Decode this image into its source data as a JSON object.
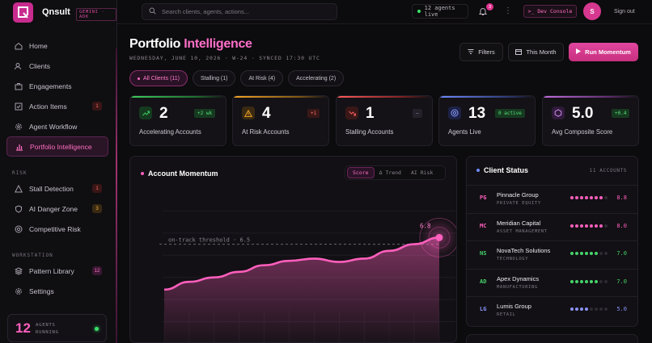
{
  "app": {
    "brand": "Qnsult",
    "badge": "GEMINI · ADK"
  },
  "sidebar": {
    "items": [
      {
        "label": "Home",
        "icon": "home-icon"
      },
      {
        "label": "Clients",
        "icon": "users-icon"
      },
      {
        "label": "Engagements",
        "icon": "briefcase-icon"
      },
      {
        "label": "Action Items",
        "icon": "checkbox-icon",
        "count": "1"
      },
      {
        "label": "Agent Workflow",
        "icon": "gear-icon"
      },
      {
        "label": "Portfolio Intelligence",
        "icon": "bar-chart-icon",
        "active": true
      }
    ],
    "risk_label": "RISK",
    "risk_items": [
      {
        "label": "Stall Detection",
        "icon": "warning-icon",
        "count": "1"
      },
      {
        "label": "AI Danger Zone",
        "icon": "shield-icon",
        "count": "3"
      },
      {
        "label": "Competitive Risk",
        "icon": "target-icon"
      }
    ],
    "workstation_label": "WORKSTATION",
    "workstation_items": [
      {
        "label": "Pattern Library",
        "icon": "layers-icon",
        "count": "12"
      },
      {
        "label": "Settings",
        "icon": "gear-icon"
      }
    ],
    "agents": {
      "count": "12",
      "label_line1": "AGENTS",
      "label_line2": "RUNNING"
    }
  },
  "topbar": {
    "search_placeholder": "Search clients, agents, actions...",
    "agents_live": "12 agents live",
    "notifications": "3",
    "dev_console": ">_ Dev Console",
    "avatar": "S",
    "sign_out": "Sign out"
  },
  "header": {
    "title_a": "Portfolio",
    "title_b": "Intelligence",
    "subline": "WEDNESDAY, JUNE 10, 2026 · W-24 · SYNCED 17:30 UTC",
    "filters_btn": "Filters",
    "month_btn": "This Month",
    "run_btn": "Run Momentum"
  },
  "filters": [
    {
      "label": "All Clients (11)",
      "active": true
    },
    {
      "label": "Stalling (1)"
    },
    {
      "label": "At Risk (4)"
    },
    {
      "label": "Accelerating (2)"
    }
  ],
  "kpis": [
    {
      "value": "2",
      "label": "Accelerating Accounts",
      "delta": "+2 wk",
      "icon": "trend-up-icon",
      "color": "#3ecf5c"
    },
    {
      "value": "4",
      "label": "At Risk Accounts",
      "delta": "+1",
      "icon": "warning-icon",
      "color": "#f5a524"
    },
    {
      "value": "1",
      "label": "Stalling Accounts",
      "delta": "–",
      "icon": "trend-down-icon",
      "color": "#ff5b5b"
    },
    {
      "value": "13",
      "label": "Agents Live",
      "delta": "0 active",
      "icon": "target-icon",
      "color": "#6f8cff"
    },
    {
      "value": "5.0",
      "label": "Avg Composite Score",
      "delta": "+0.4",
      "icon": "hexagon-icon",
      "color": "#c46ee0"
    }
  ],
  "momentum": {
    "title": "Account Momentum",
    "tabs": [
      "Score",
      "Δ Trend",
      "AI Risk"
    ],
    "threshold_label": "on-track threshold · 6.5"
  },
  "chart_data": {
    "type": "area",
    "y": [
      4.45,
      4.8,
      5.0,
      5.25,
      5.55,
      5.75,
      5.85,
      5.7,
      5.85,
      6.2,
      6.5,
      6.8
    ],
    "ylim": [
      2,
      9
    ],
    "threshold": 6.5,
    "last_label": "6.8",
    "color": "#ff5fbd",
    "grid": true
  },
  "client_status": {
    "title": "Client Status",
    "count": "11 ACCOUNTS",
    "rows": [
      {
        "initials": "PG",
        "name": "Pinnacle Group",
        "sector": "PRIVATE EQUITY",
        "score": "8.8",
        "filled": 7,
        "color": "#ff5fbd"
      },
      {
        "initials": "MC",
        "name": "Meridian Capital",
        "sector": "ASSET MANAGEMENT",
        "score": "8.0",
        "filled": 7,
        "color": "#ff5fbd"
      },
      {
        "initials": "NS",
        "name": "NovaTech Solutions",
        "sector": "TECHNOLOGY",
        "score": "7.0",
        "filled": 6,
        "color": "#46d36a"
      },
      {
        "initials": "AD",
        "name": "Apex Dynamics",
        "sector": "MANUFACTURING",
        "score": "7.0",
        "filled": 6,
        "color": "#46d36a"
      },
      {
        "initials": "LG",
        "name": "Lumis Group",
        "sector": "RETAIL",
        "score": "5.0",
        "filled": 4,
        "color": "#8b93ff"
      }
    ]
  }
}
